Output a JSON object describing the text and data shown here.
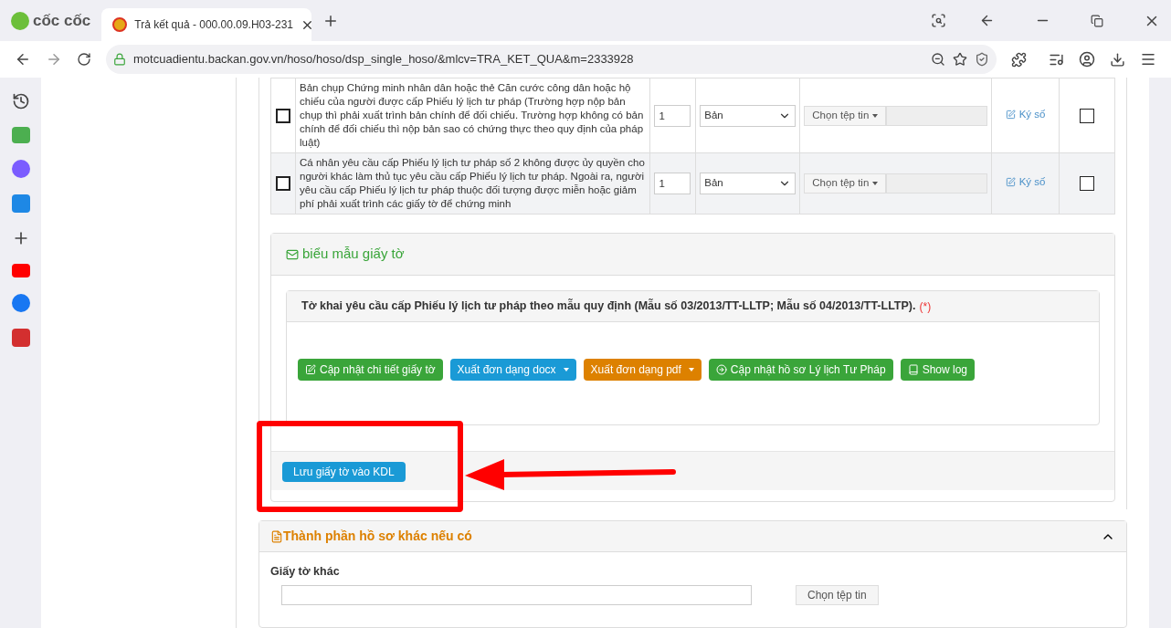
{
  "browser": {
    "brand": "cốc cốc",
    "tab_title": "Trả kết quả - 000.00.09.H03-231",
    "url": "motcuadientu.backan.gov.vn/hoso/hoso/dsp_single_hoso/&mlcv=TRA_KET_QUA&m=2333928"
  },
  "documents": [
    {
      "text": "Bản chụp Chứng minh nhân dân hoặc thẻ Căn cước công dân hoặc hộ chiếu của người được cấp Phiếu lý lịch tư pháp (Trường hợp nộp bản chụp thì phải xuất trình bản chính để đối chiếu. Trường hợp không có bản chính để đối chiếu thì nộp bản sao có chứng thực theo quy định của pháp luật)",
      "checked": false,
      "quantity": "1",
      "unit": "Bản",
      "file_button": "Chọn tệp tin",
      "sign_link": "Ký số",
      "signed": false,
      "confirmed": false
    },
    {
      "text": "Cá nhân yêu cầu cấp Phiếu lý lịch tư pháp số 2 không được ủy quyền cho người khác làm thủ tục yêu cầu cấp Phiếu lý lịch tư pháp. Ngoài ra, người yêu cầu cấp Phiếu lý lịch tư pháp thuộc đối tượng được miễn hoặc giảm phí phải xuất trình các giấy tờ để chứng minh",
      "checked": false,
      "quantity": "1",
      "unit": "Bản",
      "file_button": "Chọn tệp tin",
      "sign_link": "Ký số",
      "signed": false,
      "confirmed": false
    }
  ],
  "forms_panel": {
    "title": "biểu mẫu giấy tờ",
    "form_title": "Tờ khai yêu cầu cấp Phiếu lý lịch tư pháp theo mẫu quy định (Mẫu số 03/2013/TT-LLTP; Mẫu số 04/2013/TT-LLTP).",
    "required_mark": "(*)",
    "buttons": [
      {
        "label": "Cập nhật chi tiết giấy tờ",
        "kind": "success",
        "dropdown": false
      },
      {
        "label": "Xuất đơn dạng docx",
        "kind": "info",
        "dropdown": true
      },
      {
        "label": "Xuất đơn dạng pdf",
        "kind": "warning",
        "dropdown": true
      },
      {
        "label": "Cập nhật hồ sơ Lý lịch Tư Pháp",
        "kind": "success",
        "dropdown": false
      },
      {
        "label": "Show log",
        "kind": "success",
        "dropdown": false
      }
    ]
  },
  "save_button": "Lưu giấy tờ vào KDL",
  "other_panel": {
    "title": "Thành phần hồ sơ khác nếu có",
    "expanded": true,
    "field_label": "Giấy tờ khác",
    "file_button": "Chọn tệp tin"
  }
}
